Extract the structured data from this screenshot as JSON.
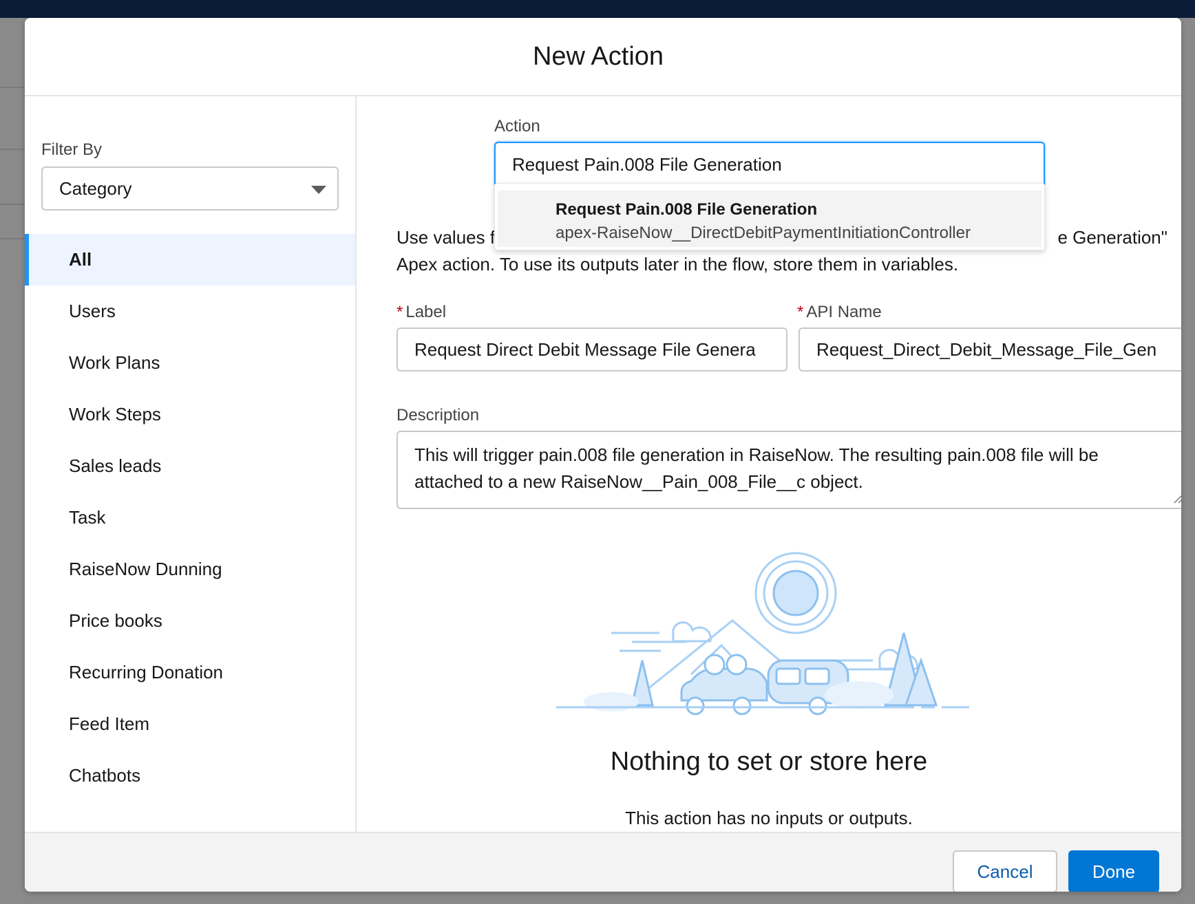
{
  "modal": {
    "title": "New Action"
  },
  "sidebar": {
    "filter_label": "Filter By",
    "filter_value": "Category",
    "categories": [
      {
        "label": "All",
        "active": true
      },
      {
        "label": "Users"
      },
      {
        "label": "Work Plans"
      },
      {
        "label": "Work Steps"
      },
      {
        "label": "Sales leads"
      },
      {
        "label": "Task"
      },
      {
        "label": "RaiseNow Dunning"
      },
      {
        "label": "Price books"
      },
      {
        "label": "Recurring Donation"
      },
      {
        "label": "Feed Item"
      },
      {
        "label": "Chatbots"
      }
    ]
  },
  "action": {
    "label": "Action",
    "value": "Request Pain.008 File Generation",
    "suggestion": {
      "title": "Request Pain.008 File Generation",
      "subtitle": "apex-RaiseNow__DirectDebitPaymentInitiationController"
    }
  },
  "helper": {
    "visible_left": "Use values fro",
    "visible_right": "e Generation\"",
    "line2": "Apex action. To use its outputs later in the flow, store them in variables."
  },
  "fields": {
    "required_marker": "*",
    "label_label": "Label",
    "label_value": "Request Direct Debit Message File Genera",
    "api_label": "API Name",
    "api_value": "Request_Direct_Debit_Message_File_Gen",
    "description_label": "Description",
    "description_value": "This will trigger pain.008 file generation in RaiseNow. The resulting pain.008 file will be attached to a new RaiseNow__Pain_008_File__c object."
  },
  "empty_state": {
    "title": "Nothing to set or store here",
    "subtitle": "This action has no inputs or outputs."
  },
  "footer": {
    "cancel_label": "Cancel",
    "done_label": "Done"
  },
  "colors": {
    "brand": "#0176d3",
    "focus": "#1b96ff",
    "required": "#ba0517",
    "header_bar": "#0b1c38"
  }
}
